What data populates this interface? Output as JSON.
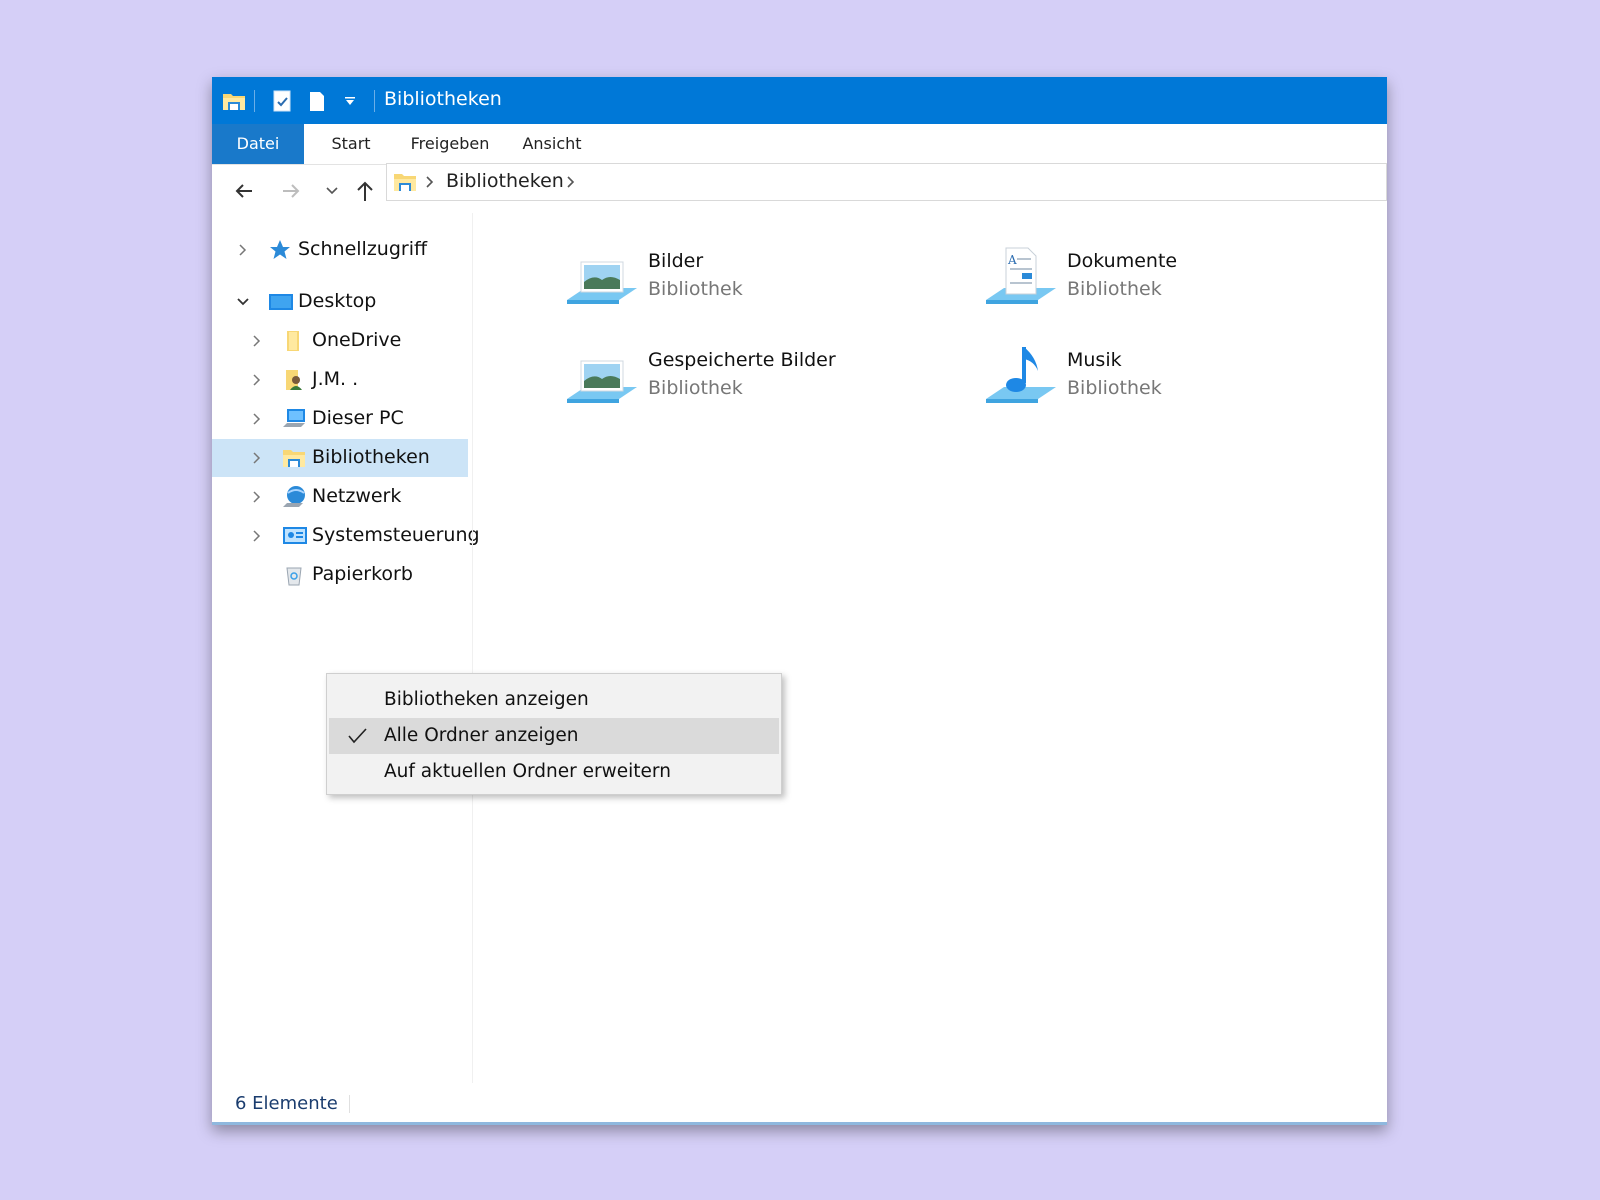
{
  "window": {
    "title": "Bibliotheken",
    "ribbon_tabs": [
      "Datei",
      "Start",
      "Freigeben",
      "Ansicht"
    ],
    "active_tab": "Datei",
    "accent_color": "#0078d7"
  },
  "address": {
    "breadcrumb": "Bibliotheken"
  },
  "nav": {
    "items": [
      {
        "label": "Schnellzugriff",
        "icon": "star-icon",
        "expander": "collapsed"
      },
      {
        "label": "Desktop",
        "icon": "desktop-icon",
        "expander": "expanded"
      },
      {
        "label": "OneDrive",
        "icon": "folder-icon",
        "expander": "collapsed"
      },
      {
        "label": "J.M. .",
        "icon": "user-folder-icon",
        "expander": "collapsed"
      },
      {
        "label": "Dieser PC",
        "icon": "computer-icon",
        "expander": "collapsed"
      },
      {
        "label": "Bibliotheken",
        "icon": "libraries-icon",
        "expander": "collapsed",
        "selected": true
      },
      {
        "label": "Netzwerk",
        "icon": "network-icon",
        "expander": "collapsed"
      },
      {
        "label": "Systemsteuerung",
        "icon": "control-panel-icon",
        "expander": "collapsed"
      },
      {
        "label": "Papierkorb",
        "icon": "recycle-bin-icon",
        "expander": "none"
      }
    ]
  },
  "libraries": [
    {
      "name": "Bilder",
      "type": "Bibliothek",
      "icon": "pictures-library-icon"
    },
    {
      "name": "Dokumente",
      "type": "Bibliothek",
      "icon": "documents-library-icon"
    },
    {
      "name": "Gespeicherte Bilder",
      "type": "Bibliothek",
      "icon": "saved-pictures-library-icon"
    },
    {
      "name": "Musik",
      "type": "Bibliothek",
      "icon": "music-library-icon"
    }
  ],
  "context_menu": {
    "items": [
      {
        "label": "Bibliotheken anzeigen",
        "checked": false
      },
      {
        "label": "Alle Ordner anzeigen",
        "checked": true
      },
      {
        "label": "Auf aktuellen Ordner erweitern",
        "checked": false
      }
    ]
  },
  "status": {
    "item_count": "6 Elemente"
  }
}
